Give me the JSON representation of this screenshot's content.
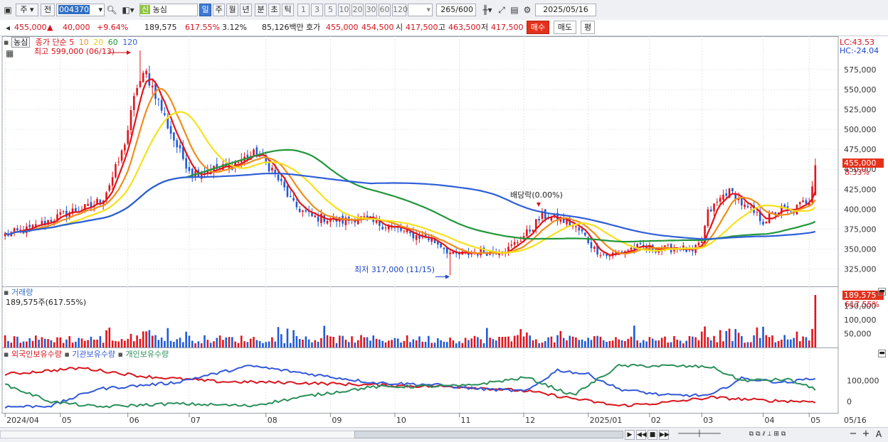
{
  "toolbar": {
    "market_type": "주",
    "prev_label": "전",
    "code": "004370",
    "name": "농심",
    "sin_badge": "신",
    "periods": [
      "일",
      "주",
      "월",
      "년",
      "분",
      "초",
      "틱"
    ],
    "selected_period": "일",
    "minutes": [
      "1",
      "3",
      "5",
      "10",
      "20",
      "30",
      "60",
      "120"
    ],
    "count": "265",
    "count_total": "/600",
    "date": "2025/05/16"
  },
  "quote": {
    "price": "455,000",
    "change": "40,000",
    "change_pct": "+9.64%",
    "volume": "189,575",
    "volume_pct": "617.55%",
    "turnover_pct": "3.12%",
    "amount": "85,126백만",
    "hoga_label": "호가",
    "ask": "455,000",
    "bid": "454,500",
    "open_label": "시",
    "open": "417,500",
    "high_label": "고",
    "high": "463,500",
    "low_label": "저",
    "low": "417,500",
    "buy_label": "매수",
    "sell_label": "매도",
    "eval_label": "평"
  },
  "price_pane": {
    "stock_tag": "농심",
    "legend_prefix": "종가 단순",
    "ma_periods": [
      "5",
      "10",
      "20",
      "60",
      "120"
    ],
    "ma_colors": [
      "#e2151c",
      "#f08d1c",
      "#f7e01b",
      "#22963a",
      "#2f5fd8"
    ],
    "lc": "LC:43.53",
    "hc": "HC:-24.04",
    "high_note": "최고 599,000 (06/13)",
    "low_note": "최저 317,000 (11/15)",
    "dividend_note": "배당락(0.00%)",
    "current_price_tag": "455,000",
    "current_change_tag": "8.33%"
  },
  "volume_pane": {
    "title": "거래량",
    "subtitle": "189,575주(617.55%)",
    "current_tag": "189,575",
    "current_pct_tag": "617.55%"
  },
  "holdings_pane": {
    "legend": [
      "외국인보유수량",
      "기관보유수량",
      "개인보유수량"
    ],
    "colors": [
      "#d9141c",
      "#3358d8",
      "#2a8f5a"
    ]
  },
  "chart_data": [
    {
      "type": "candlestick",
      "title": "농심",
      "x_labels": [
        "2024/04",
        "05",
        "06",
        "07",
        "08",
        "09",
        "10",
        "11",
        "12",
        "2025/01",
        "02",
        "03",
        "04",
        "05",
        "05/16"
      ],
      "ylim": [
        305000,
        615000
      ],
      "y_ticks": [
        325000,
        350000,
        375000,
        400000,
        425000,
        450000,
        475000,
        500000,
        525000,
        550000,
        575000
      ],
      "y_tick_labels": [
        "325,000",
        "350,000",
        "375,000",
        "400,000",
        "425,000",
        "450,000",
        "475,000",
        "500,000",
        "525,000",
        "550,000",
        "575,000"
      ],
      "close_anchors": [
        [
          0,
          368000
        ],
        [
          8,
          375000
        ],
        [
          15,
          387000
        ],
        [
          22,
          398000
        ],
        [
          28,
          403000
        ],
        [
          32,
          415000
        ],
        [
          35,
          440000
        ],
        [
          38,
          470000
        ],
        [
          40,
          500000
        ],
        [
          43,
          555000
        ],
        [
          46,
          570000
        ],
        [
          49,
          545000
        ],
        [
          53,
          505000
        ],
        [
          57,
          470000
        ],
        [
          61,
          445000
        ],
        [
          67,
          450000
        ],
        [
          72,
          452000
        ],
        [
          77,
          462000
        ],
        [
          82,
          470000
        ],
        [
          87,
          450000
        ],
        [
          91,
          425000
        ],
        [
          94,
          405000
        ],
        [
          100,
          390000
        ],
        [
          106,
          388000
        ],
        [
          110,
          385000
        ],
        [
          115,
          390000
        ],
        [
          120,
          383000
        ],
        [
          126,
          378000
        ],
        [
          132,
          368000
        ],
        [
          137,
          365000
        ],
        [
          142,
          355000
        ],
        [
          146,
          342000
        ],
        [
          152,
          345000
        ],
        [
          158,
          347000
        ],
        [
          164,
          350000
        ],
        [
          170,
          370000
        ],
        [
          175,
          392000
        ],
        [
          180,
          388000
        ],
        [
          184,
          382000
        ],
        [
          188,
          370000
        ],
        [
          192,
          350000
        ],
        [
          196,
          342000
        ],
        [
          200,
          345000
        ],
        [
          205,
          352000
        ],
        [
          210,
          351000
        ],
        [
          215,
          350000
        ],
        [
          220,
          352000
        ],
        [
          224,
          345000
        ],
        [
          227,
          360000
        ],
        [
          229,
          395000
        ],
        [
          232,
          408000
        ],
        [
          235,
          422000
        ],
        [
          238,
          418000
        ],
        [
          241,
          402000
        ],
        [
          244,
          395000
        ],
        [
          247,
          385000
        ],
        [
          250,
          393000
        ],
        [
          253,
          400000
        ],
        [
          256,
          395000
        ],
        [
          259,
          405000
        ],
        [
          262,
          413000
        ],
        [
          264,
          455000
        ]
      ],
      "high": 599000,
      "high_date": "06/13",
      "low": 317000,
      "low_date": "11/15",
      "last_close": 455000,
      "last_change_pct": 8.33,
      "moving_averages": [
        5,
        10,
        20,
        60,
        120
      ]
    },
    {
      "type": "bar",
      "title": "거래량",
      "y_ticks": [
        50000,
        100000,
        150000
      ],
      "y_tick_labels": [
        "50,000",
        "100,000",
        "150,000"
      ],
      "ylim": [
        0,
        200000
      ],
      "last_value": 189575,
      "last_pct": 617.55
    },
    {
      "type": "line",
      "series_names": [
        "외국인보유수량",
        "기관보유수량",
        "개인보유수량"
      ],
      "y_ticks": [
        0,
        100000
      ],
      "y_tick_labels": [
        "0",
        "100,000"
      ],
      "ylim": [
        -40000,
        210000
      ],
      "foreign_anchors": [
        [
          0,
          130000
        ],
        [
          25,
          160000
        ],
        [
          45,
          120000
        ],
        [
          70,
          95000
        ],
        [
          95,
          90000
        ],
        [
          130,
          75000
        ],
        [
          150,
          70000
        ],
        [
          170,
          50000
        ],
        [
          185,
          15000
        ],
        [
          200,
          -20000
        ],
        [
          215,
          -5000
        ],
        [
          230,
          20000
        ],
        [
          248,
          5000
        ],
        [
          264,
          0
        ]
      ],
      "inst_anchors": [
        [
          0,
          -25000
        ],
        [
          15,
          -20000
        ],
        [
          30,
          60000
        ],
        [
          55,
          90000
        ],
        [
          80,
          170000
        ],
        [
          100,
          130000
        ],
        [
          120,
          90000
        ],
        [
          140,
          80000
        ],
        [
          155,
          60000
        ],
        [
          170,
          50000
        ],
        [
          180,
          150000
        ],
        [
          190,
          130000
        ],
        [
          200,
          60000
        ],
        [
          215,
          30000
        ],
        [
          230,
          30000
        ],
        [
          240,
          110000
        ],
        [
          255,
          90000
        ],
        [
          264,
          115000
        ]
      ],
      "indiv_anchors": [
        [
          0,
          80000
        ],
        [
          15,
          0
        ],
        [
          30,
          -25000
        ],
        [
          55,
          -10000
        ],
        [
          80,
          -20000
        ],
        [
          100,
          30000
        ],
        [
          120,
          70000
        ],
        [
          150,
          75000
        ],
        [
          170,
          115000
        ],
        [
          185,
          30000
        ],
        [
          200,
          170000
        ],
        [
          215,
          170000
        ],
        [
          230,
          165000
        ],
        [
          240,
          100000
        ],
        [
          255,
          105000
        ],
        [
          264,
          60000
        ]
      ]
    }
  ],
  "bottom": {
    "zoom_minus": "−",
    "zoom_plus": "+",
    "zoom_reset": "A"
  }
}
